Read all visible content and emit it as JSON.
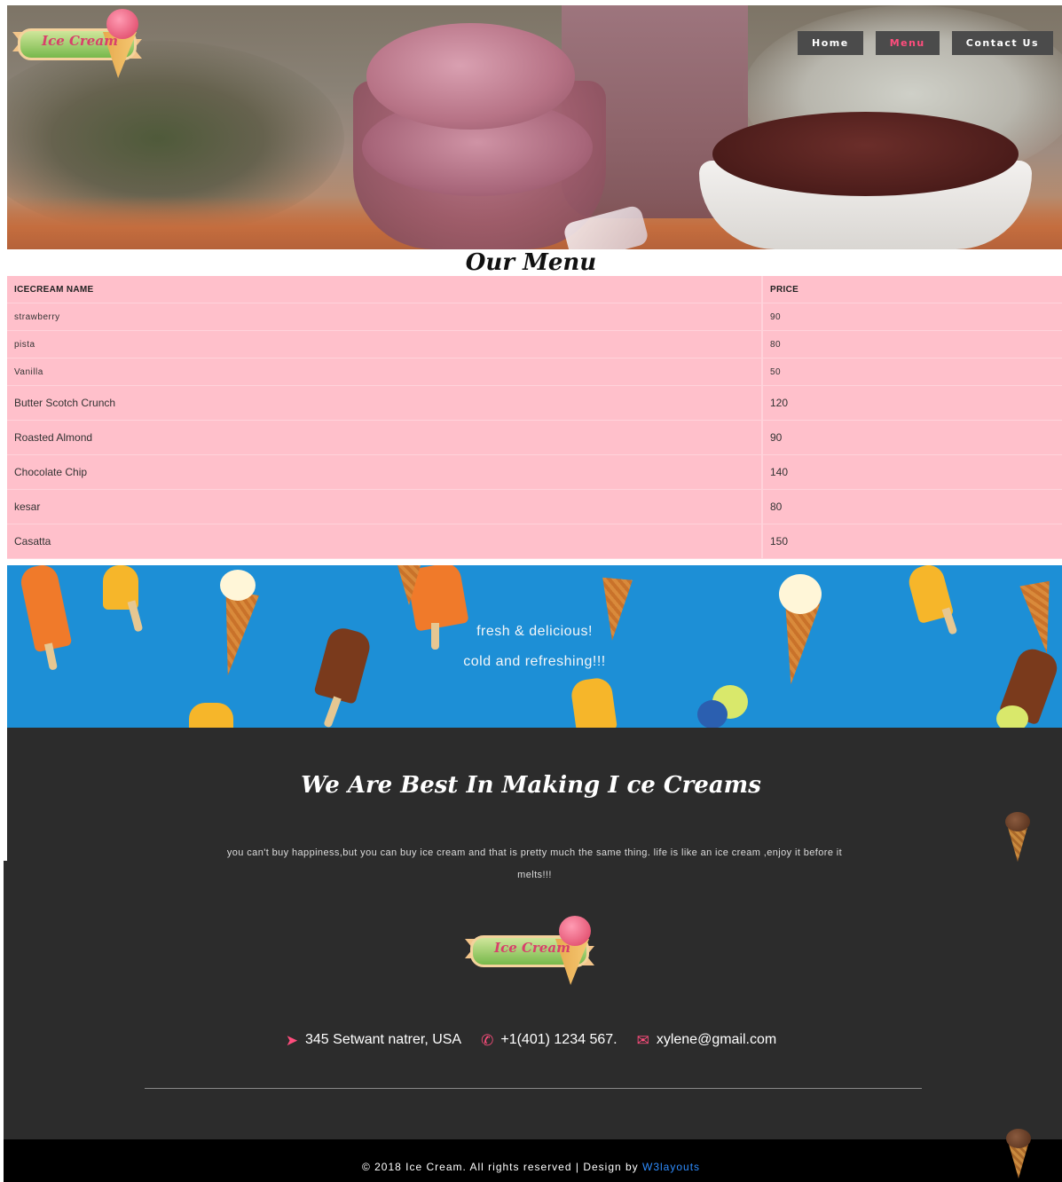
{
  "brand": {
    "logo_text": "Ice Cream"
  },
  "nav": {
    "items": [
      {
        "label": "Home",
        "active": false
      },
      {
        "label": "Menu",
        "active": true
      },
      {
        "label": "Contact Us",
        "active": false
      }
    ],
    "active_color": "#ff4d7d"
  },
  "menu": {
    "title": "Our Menu",
    "columns": [
      "ICECREAM NAME",
      "PRICE"
    ],
    "rows": [
      {
        "name": "strawberry",
        "price": "90"
      },
      {
        "name": "pista",
        "price": "80"
      },
      {
        "name": "Vanilla",
        "price": "50"
      },
      {
        "name": "Butter Scotch Crunch",
        "price": "120"
      },
      {
        "name": "Roasted Almond",
        "price": "90"
      },
      {
        "name": "Chocolate Chip",
        "price": "140"
      },
      {
        "name": "kesar",
        "price": "80"
      },
      {
        "name": "Casatta",
        "price": "150"
      }
    ],
    "table_color": "#ffc0cb"
  },
  "banner": {
    "line1": "fresh & delicious!",
    "line2": "cold and refreshing!!!",
    "bg_color": "#1d8fd6"
  },
  "about": {
    "title": "We Are Best In Making I ce Creams",
    "text": "you can't buy happiness,but you can buy ice cream and that is pretty much the same thing. life is like an ice cream ,enjoy it before it melts!!!"
  },
  "contact": {
    "address": "345 Setwant natrer, USA",
    "phone": "+1(401) 1234 567.",
    "email": "xylene@gmail.com",
    "address_icon": "location-arrow-icon",
    "phone_icon": "phone-icon",
    "email_icon": "envelope-open-icon"
  },
  "footer": {
    "copyright": "© 2018 Ice Cream. All rights reserved | Design by ",
    "designer_link": "W3layouts",
    "link_color": "#2f8dff"
  }
}
